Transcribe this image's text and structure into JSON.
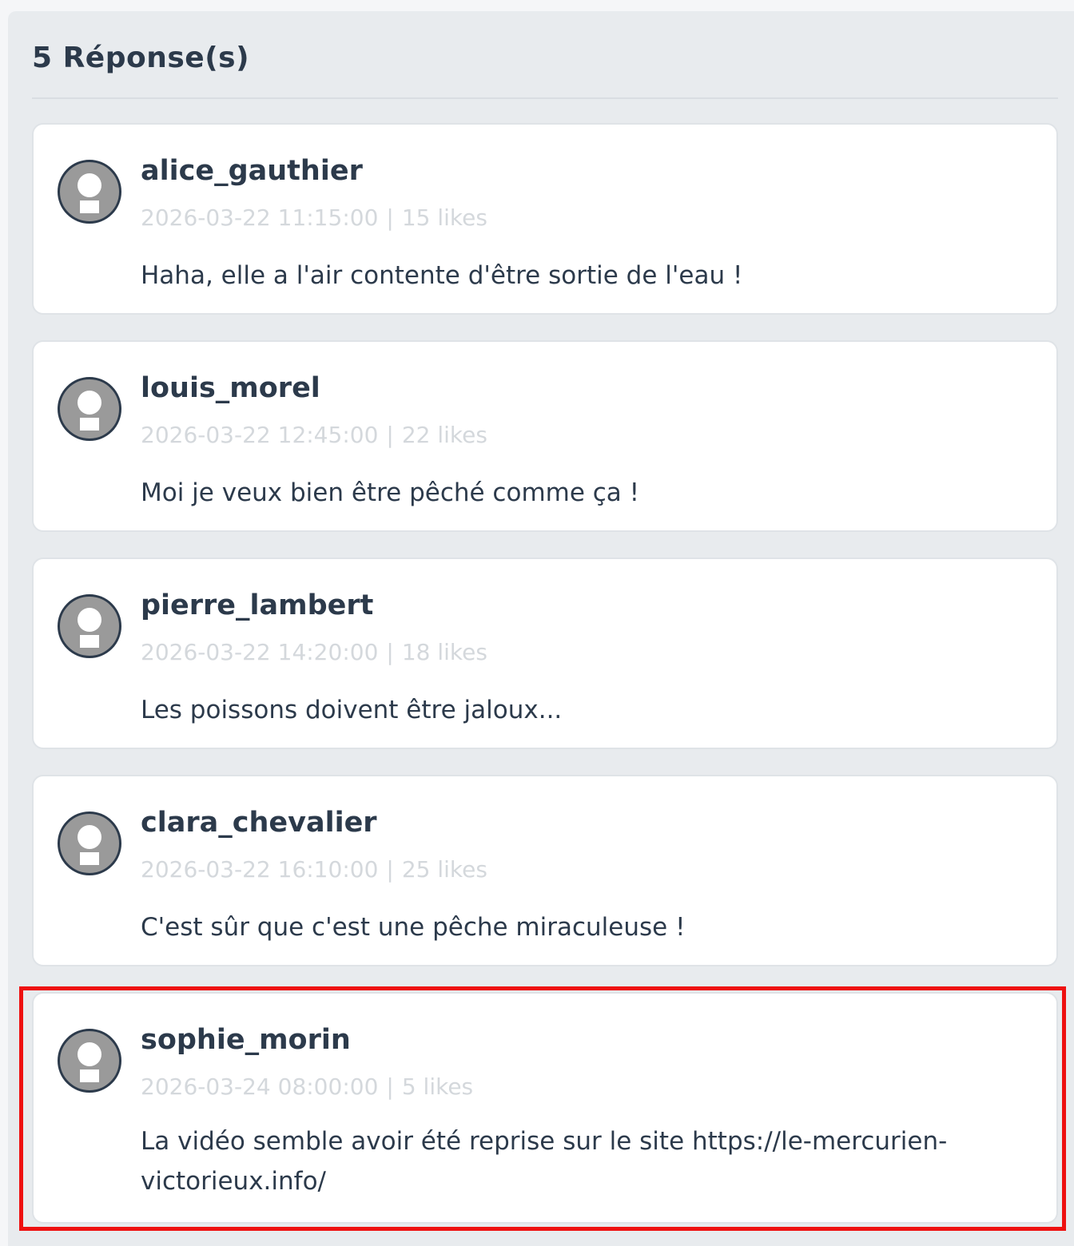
{
  "panel": {
    "title": "5 Réponse(s)"
  },
  "comments": [
    {
      "username": "alice_gauthier",
      "datetime": "2026-03-22 11:15:00",
      "separator": "|",
      "likes": "15 likes",
      "text": "Haha, elle a l'air contente d'être sortie de l'eau !"
    },
    {
      "username": "louis_morel",
      "datetime": "2026-03-22 12:45:00",
      "separator": "|",
      "likes": "22 likes",
      "text": "Moi je veux bien être pêché comme ça !"
    },
    {
      "username": "pierre_lambert",
      "datetime": "2026-03-22 14:20:00",
      "separator": "|",
      "likes": "18 likes",
      "text": "Les poissons doivent être jaloux..."
    },
    {
      "username": "clara_chevalier",
      "datetime": "2026-03-22 16:10:00",
      "separator": "|",
      "likes": "25 likes",
      "text": "C'est sûr que c'est une pêche miraculeuse !"
    },
    {
      "username": "sophie_morin",
      "datetime": "2026-03-24 08:00:00",
      "separator": "|",
      "likes": "5 likes",
      "text": "La vidéo semble avoir été reprise sur le site https://le-mercurien-victorieux.info/"
    }
  ],
  "icons": {
    "avatar": "user-avatar-icon"
  },
  "colors": {
    "panel_bg": "#e8ebee",
    "card_bg": "#ffffff",
    "text": "#2c3a4b",
    "meta": "#d4d8dc",
    "avatar": "#9a9a9a",
    "highlight": "#ee1111"
  }
}
